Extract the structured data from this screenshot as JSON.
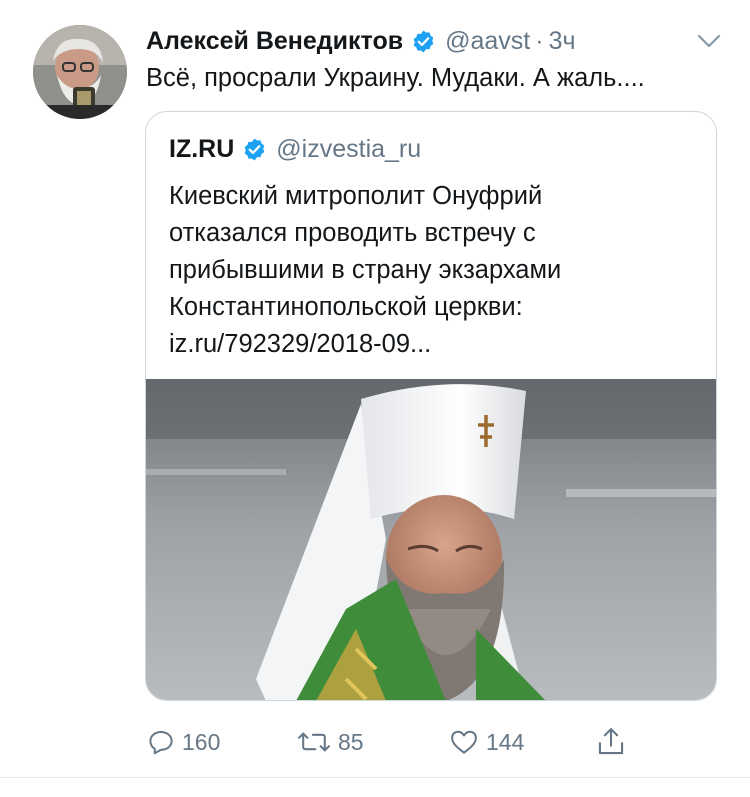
{
  "tweet": {
    "author_name": "Алексей Венедиктов",
    "handle": "@aavst",
    "separator": "·",
    "time": "3ч",
    "text": "Всё, просрали Украину. Мудаки. А жаль....",
    "verified_color": "#1da1f2"
  },
  "quoted": {
    "author_name": "IZ.RU",
    "handle": "@izvestia_ru",
    "lines": [
      "Киевский митрополит Онуфрий",
      "отказался проводить встречу с",
      "прибывшими в страну экзархами",
      "Константинопольской церкви:",
      "iz.ru/792329/2018-09..."
    ]
  },
  "actions": {
    "reply_count": "160",
    "retweet_count": "85",
    "like_count": "144",
    "icons": [
      "reply-icon",
      "retweet-icon",
      "like-icon",
      "share-icon"
    ]
  },
  "colors": {
    "text": "#14171a",
    "secondary": "#657786",
    "border": "#ccd6dd",
    "verified": "#1da1f2"
  }
}
